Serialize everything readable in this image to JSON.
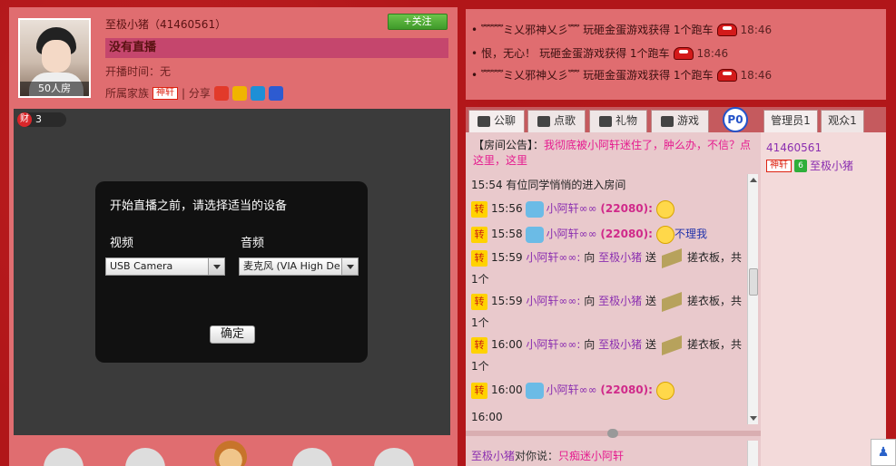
{
  "anchor": {
    "name": "至极小猪（41460561）",
    "room_count_label": "50人房",
    "follow_label": "+关注",
    "status": "没有直播",
    "start_time": "开播时间：无",
    "family_label": "所属家族",
    "family_badge": "神轩",
    "share_label": "| 分享"
  },
  "stage": {
    "wealth_icon": "财",
    "wealth_value": "3"
  },
  "device_dialog": {
    "title": "开始直播之前，请选择适当的设备",
    "video_label": "视频",
    "audio_label": "音频",
    "video_value": "USB Camera",
    "audio_value": "麦克风 (VIA High De",
    "confirm_label": "确定"
  },
  "notices": [
    {
      "user": "﹌﹌ミ乂邪神乂彡﹌",
      "text": "玩砸金蛋游戏获得 1个跑车",
      "time": "18:46"
    },
    {
      "user": "恨，无心！",
      "text": "玩砸金蛋游戏获得 1个跑车",
      "time": "18:46"
    },
    {
      "user": "﹌﹌ミ乂邪神乂彡﹌",
      "text": "玩砸金蛋游戏获得 1个跑车",
      "time": "18:46"
    }
  ],
  "chat_tabs": [
    {
      "label": "公聊",
      "icon": "chat-bubble-icon"
    },
    {
      "label": "点歌",
      "icon": "microphone-icon"
    },
    {
      "label": "礼物",
      "icon": "gift-icon"
    },
    {
      "label": "游戏",
      "icon": "gamepad-icon"
    }
  ],
  "p_badge": "P0",
  "announcement": {
    "prefix": "【房间公告】：",
    "text": "我彻底被小阿轩迷住了，肿么办，不信？点这里，这里"
  },
  "chat": {
    "m1": "15:54 有位同学悄悄的进入房间",
    "m2_time": "15:56",
    "m2_user": "小阿轩∞∞",
    "m2_id": "(22080):",
    "m3_time": "15:58",
    "m3_user": "小阿轩∞∞",
    "m3_id": "(22080):",
    "m3_text": "不理我",
    "m4_time": "15:59",
    "m4_user": "小阿轩∞∞:",
    "m4_to": "向",
    "m4_target": "至极小猪",
    "m4_send": "送",
    "m4_gift": "搓衣板，共",
    "m4_count": "1个",
    "m5_time": "15:59",
    "m5_user": "小阿轩∞∞:",
    "m5_to": "向",
    "m5_target": "至极小猪",
    "m5_send": "送",
    "m5_gift": "搓衣板，共",
    "m5_count": "1个",
    "m6_time": "16:00",
    "m6_user": "小阿轩∞∞:",
    "m6_to": "向",
    "m6_target": "至极小猪",
    "m6_send": "送",
    "m6_gift": "搓衣板，共",
    "m6_count": "1个",
    "m7_time": "16:00",
    "m7_user": "小阿轩∞∞",
    "m7_id": "(22080):",
    "m8": "16:00",
    "zhuan": "转"
  },
  "private_chat": {
    "from": "至极小猪",
    "mid": "对你说：",
    "text": "只痴迷小阿轩"
  },
  "user_tabs": [
    "管理员1",
    "观众1"
  ],
  "user_list": {
    "id": "41460561",
    "badge": "神轩",
    "level": "6",
    "name": "至极小猪"
  },
  "corner_button_icon": "person-icon"
}
